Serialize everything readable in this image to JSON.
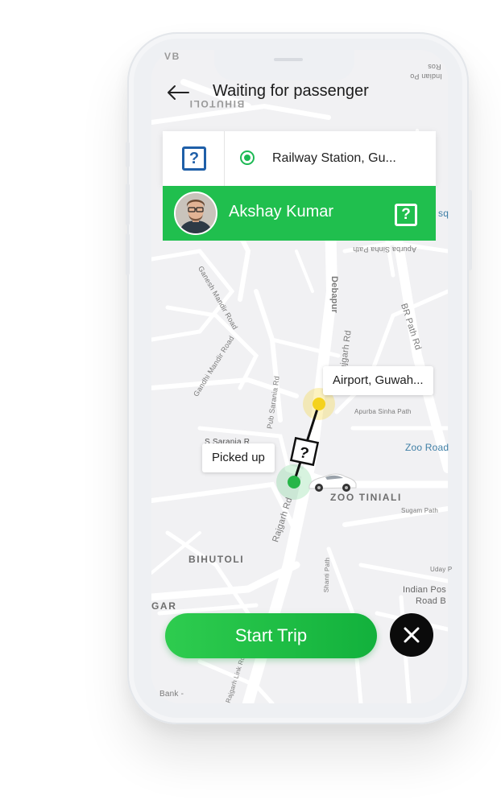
{
  "header": {
    "title": "Waiting for passenger"
  },
  "trip": {
    "pickup_location": "Railway Station, Gu...",
    "dropoff_location": "Airport, Guwah...",
    "status_label": "Picked up"
  },
  "driver": {
    "name": "Akshay Kumar"
  },
  "actions": {
    "start_trip_label": "Start Trip"
  },
  "map": {
    "labels": {
      "ab": "VB",
      "top_right": "Ros",
      "top_right2": "Indian Po",
      "bihutoli_top": "BIHUTOLI",
      "bq": "sq",
      "apurba_top": "Apurba Sinha Path",
      "debapur": "Debapur",
      "ganesh": "Ganesh Mandir Road",
      "gandhi_nagar": "Gandhi Mandir Road",
      "pub_sarania": "Pub Sarania Rd",
      "rajgarh_rd_upper": "Rajgarh Rd",
      "br_rd": "BR Path Rd",
      "apurba_sinha": "Apurba Sinha Path",
      "s_sarania": "S Sarania R",
      "zoo_road": "Zoo Road",
      "zoo_tiniali": "ZOO TINIALI",
      "sugam_path": "Sugam Path",
      "rajgarh_rd": "Rajgarh Rd",
      "bihutoli": "BIHUTOLI",
      "shanti_path": "Shanti Path",
      "uday": "Uday P",
      "indian_post": "Indian Pos",
      "road_b": "Road B",
      "gar": "GAR",
      "bank": "Bank -",
      "rajgarh_link": "Rajgarh Link Rd"
    }
  },
  "colors": {
    "accent_green": "#20bf4e",
    "icon_blue": "#1f5fa8",
    "pickup_yellow": "#f4d21c"
  }
}
